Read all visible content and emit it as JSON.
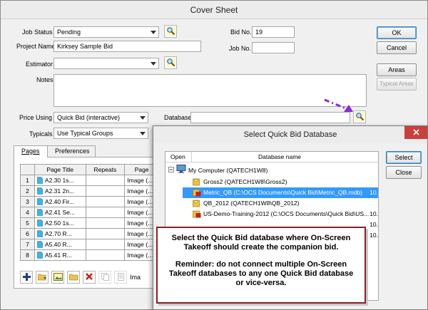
{
  "window": {
    "title": "Cover Sheet"
  },
  "form": {
    "job_status_label": "Job Status",
    "job_status_value": "Pending",
    "project_name_label": "Project Name",
    "project_name_value": "Kirksey Sample Bid",
    "estimator_label": "Estimator",
    "estimator_value": "",
    "notes_label": "Notes",
    "notes_value": "",
    "bid_no_label": "Bid No.",
    "bid_no_value": "19",
    "job_no_label": "Job No.",
    "job_no_value": "",
    "price_using_label": "Price Using",
    "price_using_value": "Quick Bid (interactive)",
    "typicals_label": "Typicals",
    "typicals_value": "Use Typical Groups",
    "database_label": "Database",
    "database_value": ""
  },
  "buttons": {
    "ok": "OK",
    "cancel": "Cancel",
    "areas": "Areas",
    "typical_areas": "Typical Areas"
  },
  "tabs": [
    {
      "label": "Pages",
      "active": true
    },
    {
      "label": "Preferences",
      "active": false
    }
  ],
  "pages_table": {
    "columns": [
      "",
      "Page Title",
      "Repeats",
      "Page"
    ],
    "rows": [
      {
        "num": "1",
        "title": "A2.30 1s...",
        "repeats": "",
        "page": "Image (..."
      },
      {
        "num": "2",
        "title": "A2.31 2n...",
        "repeats": "",
        "page": "Image (..."
      },
      {
        "num": "3",
        "title": "A2.40 Fir...",
        "repeats": "",
        "page": "Image (..."
      },
      {
        "num": "4",
        "title": "A2.41 Se...",
        "repeats": "",
        "page": "Image (..."
      },
      {
        "num": "5",
        "title": "A2.50 1s...",
        "repeats": "",
        "page": "Image (..."
      },
      {
        "num": "6",
        "title": "A2.70 R...",
        "repeats": "",
        "page": "Image (..."
      },
      {
        "num": "7",
        "title": "A5.40 R...",
        "repeats": "",
        "page": "Image (..."
      },
      {
        "num": "8",
        "title": "A5.41 R...",
        "repeats": "",
        "page": "Image (..."
      }
    ]
  },
  "toolbar_partial_label": "Ima",
  "dialog": {
    "title": "Select Quick Bid Database",
    "col_open": "Open",
    "col_name": "Database name",
    "select_button": "Select",
    "close_button": "Close",
    "tree": {
      "root": "My Computer (QATECH1W8)",
      "items": [
        {
          "name": "Gross2 (QATECH1W8\\Gross2)",
          "extra": "",
          "selected": false
        },
        {
          "name": "Metric_QB (C:\\OCS Documents\\Quick Bid\\Metric_QB.mdb)",
          "extra": "10.",
          "selected": true
        },
        {
          "name": "QB_2012 (QATECH1W8\\QB_2012)",
          "extra": "",
          "selected": false
        },
        {
          "name": "US-Demo-Training-2012 (C:\\OCS Documents\\Quick Bid\\US...",
          "extra": "10.",
          "selected": false
        },
        {
          "name": "",
          "extra": "10.",
          "selected": false
        },
        {
          "name": "",
          "extra": "10.",
          "selected": false
        }
      ]
    }
  },
  "callout": {
    "line1": "Select the Quick Bid database where On-Screen Takeoff should create the companion bid.",
    "line2": "Reminder:  do not connect multiple On-Screen Takeoff databases to any one Quick Bid database or vice-versa."
  },
  "colors": {
    "selection": "#3399ff",
    "callout_border": "#8a1f24",
    "arrow": "#8b2bd6",
    "close_red": "#c9413a"
  }
}
